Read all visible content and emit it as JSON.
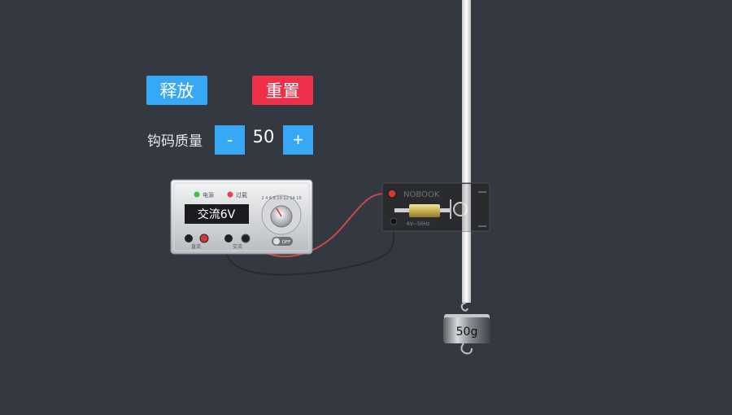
{
  "controls": {
    "release_label": "释放",
    "reset_label": "重置",
    "mass_label": "钩码质量",
    "minus_label": "-",
    "plus_label": "+",
    "mass_value": "50"
  },
  "power_supply": {
    "indicator_power": "电源",
    "indicator_overload": "过载",
    "display": "交流6V",
    "terminal_dc": "直流",
    "terminal_ac": "交流",
    "switch_label": "OFF",
    "dial_scale": "2 4 6 8 10 12 14 16"
  },
  "timer": {
    "brand": "NOBOOK",
    "spec": "6V~50Hz"
  },
  "weight": {
    "label": "50g"
  },
  "colors": {
    "background": "#343841",
    "release": "#36a8f6",
    "reset": "#f03049",
    "wire_red": "#c94848",
    "wire_black": "#2a2a2a"
  }
}
